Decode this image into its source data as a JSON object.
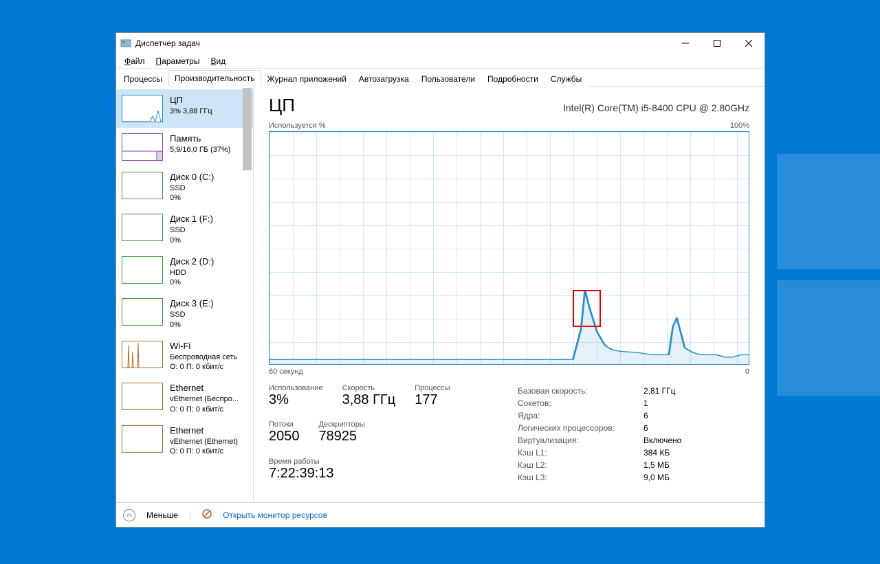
{
  "window": {
    "title": "Диспетчер задач"
  },
  "menubar": [
    "Файл",
    "Параметры",
    "Вид"
  ],
  "tabs": [
    "Процессы",
    "Производительность",
    "Журнал приложений",
    "Автозагрузка",
    "Пользователи",
    "Подробности",
    "Службы"
  ],
  "active_tab_index": 1,
  "sidebar": [
    {
      "title": "ЦП",
      "lines": [
        "3% 3,88 ГГц"
      ],
      "color": "#2c8cc9",
      "selected": true,
      "spark": "cpu"
    },
    {
      "title": "Память",
      "lines": [
        "5,9/16,0 ГБ (37%)"
      ],
      "color": "#8e44ad",
      "spark": "mem"
    },
    {
      "title": "Диск 0 (C:)",
      "lines": [
        "SSD",
        "0%"
      ],
      "color": "#3a9c3a",
      "spark": "flat"
    },
    {
      "title": "Диск 1 (F:)",
      "lines": [
        "SSD",
        "0%"
      ],
      "color": "#3a9c3a",
      "spark": "flat"
    },
    {
      "title": "Диск 2 (D:)",
      "lines": [
        "HDD",
        "0%"
      ],
      "color": "#3a9c3a",
      "spark": "flat"
    },
    {
      "title": "Диск 3 (E:)",
      "lines": [
        "SSD",
        "0%"
      ],
      "color": "#3a9c3a",
      "spark": "flat"
    },
    {
      "title": "Wi-Fi",
      "lines": [
        "Беспроводная сеть",
        "О: 0 П: 0 кбит/с"
      ],
      "color": "#b36b2c",
      "spark": "wifi"
    },
    {
      "title": "Ethernet",
      "lines": [
        "vEthernet (Беспро...",
        "О: 0 П: 0 кбит/с"
      ],
      "color": "#b36b2c",
      "spark": "flat"
    },
    {
      "title": "Ethernet",
      "lines": [
        "vEthernet (Ethernet)",
        "О: 0 П: 0 кбит/с"
      ],
      "color": "#b36b2c",
      "spark": "flat"
    }
  ],
  "main": {
    "title": "ЦП",
    "subtitle": "Intel(R) Core(TM) i5-8400 CPU @ 2.80GHz",
    "graph_top_left": "Используется %",
    "graph_top_right": "100%",
    "graph_bottom_left": "60 секунд",
    "graph_bottom_right": "0"
  },
  "stats_left": [
    {
      "label": "Использование",
      "value": "3%"
    },
    {
      "label": "Скорость",
      "value": "3,88 ГГц"
    },
    {
      "label": "Процессы",
      "value": "177"
    },
    {
      "label": "Потоки",
      "value": "2050"
    },
    {
      "label": "Дескрипторы",
      "value": "78925"
    },
    {
      "label": "Время работы",
      "value": "7:22:39:13",
      "wide": true
    }
  ],
  "stats_right": [
    {
      "label": "Базовая скорость:",
      "value": "2,81 ГГц"
    },
    {
      "label": "Сокетов:",
      "value": "1"
    },
    {
      "label": "Ядра:",
      "value": "6"
    },
    {
      "label": "Логических процессоров:",
      "value": "6"
    },
    {
      "label": "Виртуализация:",
      "value": "Включено"
    },
    {
      "label": "Кэш L1:",
      "value": "384 КБ"
    },
    {
      "label": "Кэш L2:",
      "value": "1,5 МБ"
    },
    {
      "label": "Кэш L3:",
      "value": "9,0 МБ"
    }
  ],
  "footer": {
    "less": "Меньше",
    "open_resmon": "Открыть монитор ресурсов"
  },
  "chart_data": {
    "type": "line",
    "title": "ЦП — Используется %",
    "xlabel": "секунд",
    "ylabel": "%",
    "xlim": [
      60,
      0
    ],
    "ylim": [
      0,
      100
    ],
    "x": [
      60,
      58,
      56,
      54,
      52,
      50,
      48,
      46,
      44,
      42,
      40,
      38,
      36,
      34,
      32,
      30,
      28,
      26,
      24,
      22,
      21,
      20.5,
      20,
      19,
      18,
      17,
      16,
      14,
      12,
      10,
      9.5,
      9,
      8,
      7,
      6,
      5,
      4,
      3,
      2,
      1,
      0
    ],
    "values": [
      2,
      2,
      2,
      2,
      2,
      2,
      2,
      2,
      2,
      2,
      2,
      2,
      2,
      2,
      2,
      2,
      2,
      2,
      2,
      2,
      15,
      32,
      25,
      14,
      8,
      6,
      5.5,
      5,
      4,
      4,
      16,
      20,
      7,
      5,
      4,
      4,
      4,
      3,
      3,
      4,
      4
    ],
    "highlight_box": {
      "x_min": 22,
      "x_max": 18.5,
      "y_min": 16,
      "y_max": 32
    }
  }
}
